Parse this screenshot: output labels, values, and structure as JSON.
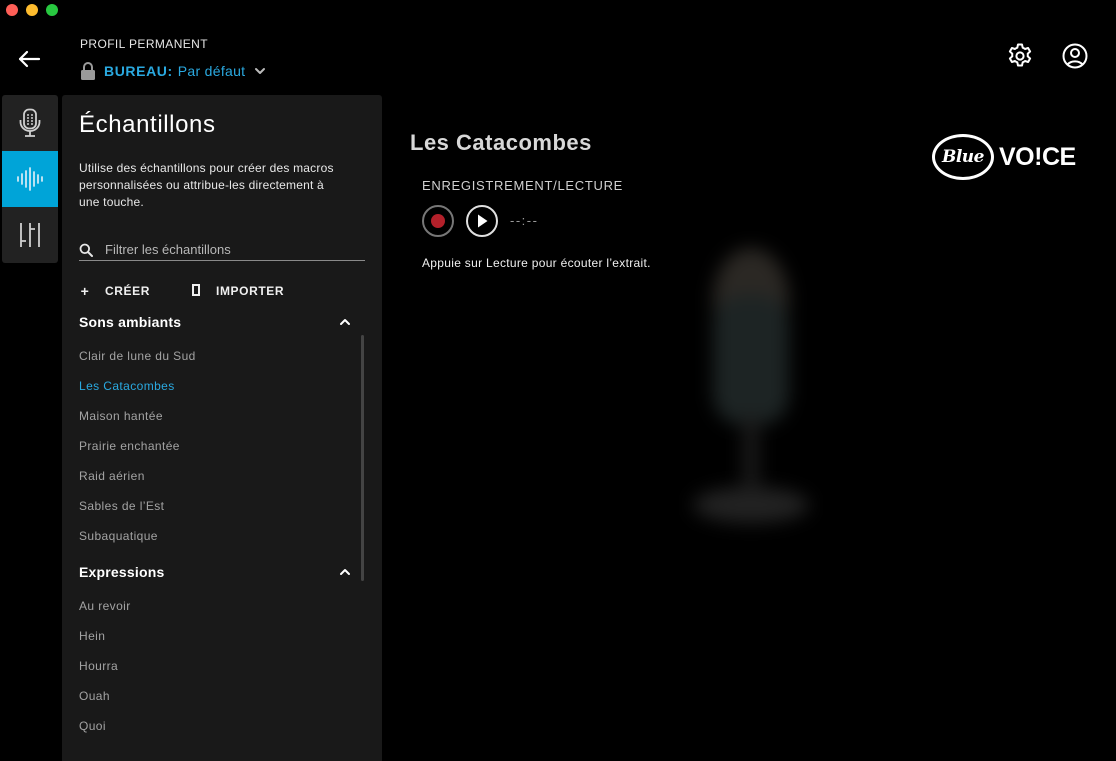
{
  "header": {
    "profile_label": "PROFIL PERMANENT",
    "profile_name": "BUREAU:",
    "profile_value": "Par défaut"
  },
  "panel": {
    "title": "Échantillons",
    "description": "Utilise des échantillons pour créer des macros personnalisées ou attribue-les directement à une touche.",
    "filter_placeholder": "Filtrer les échantillons",
    "create_label": "CRÉER",
    "import_label": "IMPORTER",
    "groups": [
      {
        "title": "Sons ambiants",
        "items": [
          "Clair de lune du Sud",
          "Les Catacombes",
          "Maison hantée",
          "Prairie enchantée",
          "Raid aérien",
          "Sables de l’Est",
          "Subaquatique"
        ]
      },
      {
        "title": "Expressions",
        "items": [
          "Au revoir",
          "Hein",
          "Hourra",
          "Ouah",
          "Quoi"
        ]
      }
    ]
  },
  "main": {
    "title": "Les Catacombes",
    "section_label": "ENREGISTREMENT/LECTURE",
    "time": "--:--",
    "hint": "Appuie sur Lecture pour écouter l’extrait.",
    "logo_blue": "Blue",
    "logo_voice": "VO!CE"
  },
  "colors": {
    "accent": "#00a4d8",
    "record": "#b3202a",
    "panel_bg": "#191919"
  },
  "icons": [
    "back-arrow-icon",
    "lock-icon",
    "chevron-down-icon",
    "gear-icon",
    "user-icon",
    "microphone-icon",
    "waveform-icon",
    "equalizer-icon",
    "search-icon",
    "plus-icon",
    "import-icon",
    "chevron-up-icon",
    "play-icon"
  ]
}
